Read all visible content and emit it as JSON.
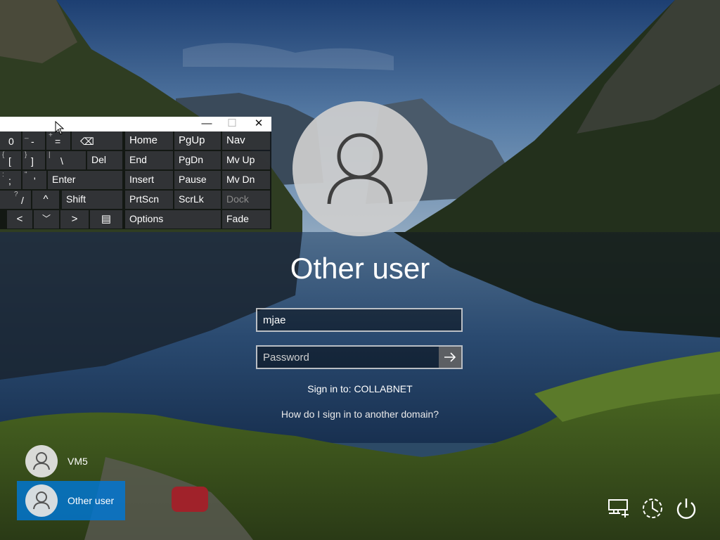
{
  "keyboard": {
    "window_buttons": {
      "minimize": "—",
      "maximize": "☐",
      "close": "✕"
    },
    "rows": [
      {
        "keys": [
          {
            "main": "0",
            "sup": ""
          },
          {
            "main": "-",
            "sup": "_"
          },
          {
            "main": "=",
            "sup": "+"
          },
          {
            "main": "⌫",
            "sup": ""
          },
          {
            "main": "Home"
          },
          {
            "main": "PgUp"
          },
          {
            "main": "Nav"
          }
        ]
      },
      {
        "keys": [
          {
            "main": "[",
            "sup": "{"
          },
          {
            "main": "]",
            "sup": "}"
          },
          {
            "main": "\\",
            "sup": "|"
          },
          {
            "main": "Del"
          },
          {
            "main": "End"
          },
          {
            "main": "PgDn"
          },
          {
            "main": "Mv Up"
          }
        ]
      },
      {
        "keys": [
          {
            "main": ";",
            "sup": ":"
          },
          {
            "main": "'",
            "sup": "\""
          },
          {
            "main": "Enter"
          },
          {
            "main": "Insert"
          },
          {
            "main": "Pause"
          },
          {
            "main": "Mv Dn"
          }
        ]
      },
      {
        "keys": [
          {
            "main": "/",
            "sup": "?"
          },
          {
            "main": "^"
          },
          {
            "main": "Shift"
          },
          {
            "main": "PrtScn"
          },
          {
            "main": "ScrLk"
          },
          {
            "main": "Dock"
          }
        ]
      },
      {
        "keys": [
          {
            "main": "<"
          },
          {
            "main": "﹀"
          },
          {
            "main": ">"
          },
          {
            "main": "▤"
          },
          {
            "main": "Options"
          },
          {
            "main": "Fade"
          }
        ]
      }
    ]
  },
  "login": {
    "user_title": "Other user",
    "username_value": "mjae",
    "password_placeholder": "Password",
    "signin_text": "Sign in to: COLLABNET",
    "domain_link": "How do I sign in to another domain?"
  },
  "users": [
    {
      "name": "VM5",
      "selected": false
    },
    {
      "name": "Other user",
      "selected": true
    }
  ],
  "icons": [
    "network-icon",
    "ease-of-access-icon",
    "power-icon"
  ],
  "colors": {
    "selected_user": "#0078d7",
    "key_bg": "#343639"
  }
}
